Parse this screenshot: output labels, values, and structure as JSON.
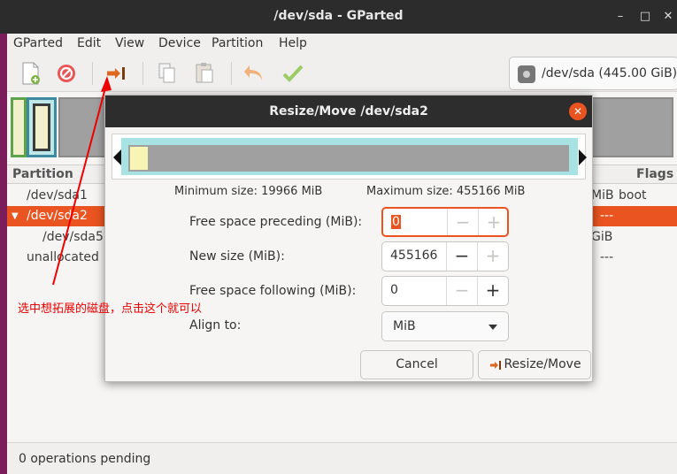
{
  "window": {
    "title": "/dev/sda - GParted",
    "controls": [
      "–",
      "□",
      "✕"
    ]
  },
  "menu": [
    "GParted",
    "Edit",
    "View",
    "Device",
    "Partition",
    "Help"
  ],
  "toolbar": {
    "device": "/dev/sda (445.00 GiB)"
  },
  "partition_list": {
    "headers": {
      "partition": "Partition",
      "flags": "Flags"
    },
    "rows": [
      {
        "name": "/dev/sda1",
        "size_tail": "MiB",
        "flags": "boot"
      },
      {
        "name": "/dev/sda2",
        "size_tail": "",
        "flags": "---"
      },
      {
        "name": "/dev/sda5",
        "size_tail": "GiB",
        "flags": ""
      },
      {
        "name": "unallocated",
        "size_tail": "",
        "flags": "---"
      }
    ]
  },
  "status": "0 operations pending",
  "dialog": {
    "title": "Resize/Move /dev/sda2",
    "min_size": "Minimum size: 19966 MiB",
    "max_size": "Maximum size: 455166 MiB",
    "fields": [
      {
        "label": "Free space preceding (MiB):",
        "value": "0"
      },
      {
        "label": "New size (MiB):",
        "value": "455166"
      },
      {
        "label": "Free space following (MiB):",
        "value": "0"
      }
    ],
    "align_label": "Align to:",
    "align_value": "MiB",
    "minus": "−",
    "plus": "+",
    "cancel": "Cancel",
    "resize": "Resize/Move",
    "close": "✕"
  },
  "annotation": "选中想拓展的磁盘，点击这个就可以",
  "colors": {
    "accent": "#e95420",
    "annotation": "#ee0000"
  }
}
